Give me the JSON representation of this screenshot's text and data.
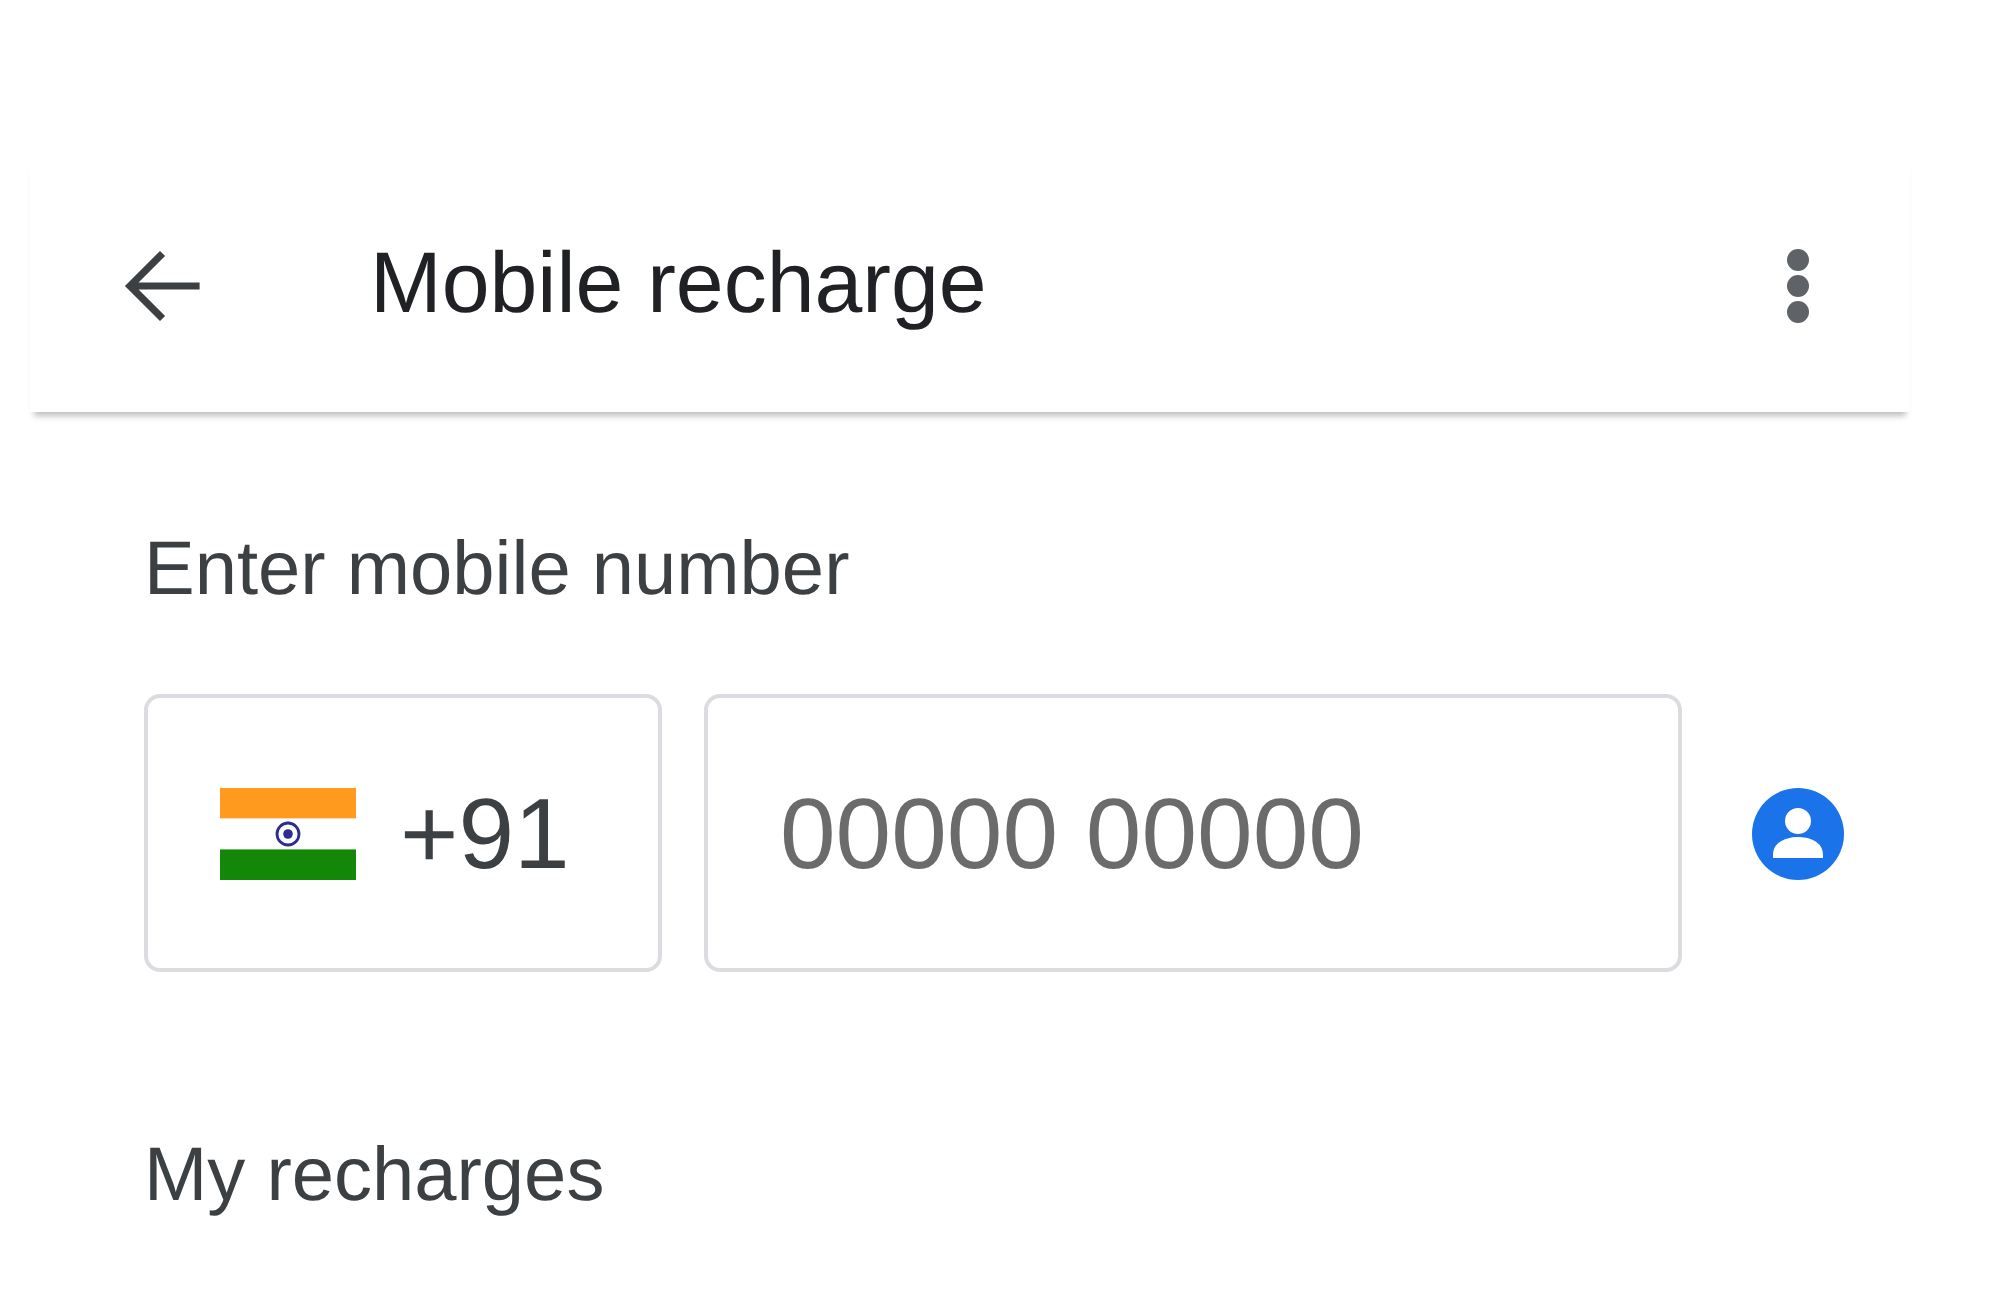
{
  "app_bar": {
    "title": "Mobile recharge"
  },
  "number_entry": {
    "heading": "Enter mobile number",
    "country_code": "+91",
    "placeholder": "00000 00000"
  },
  "recharges": {
    "heading": "My recharges"
  }
}
